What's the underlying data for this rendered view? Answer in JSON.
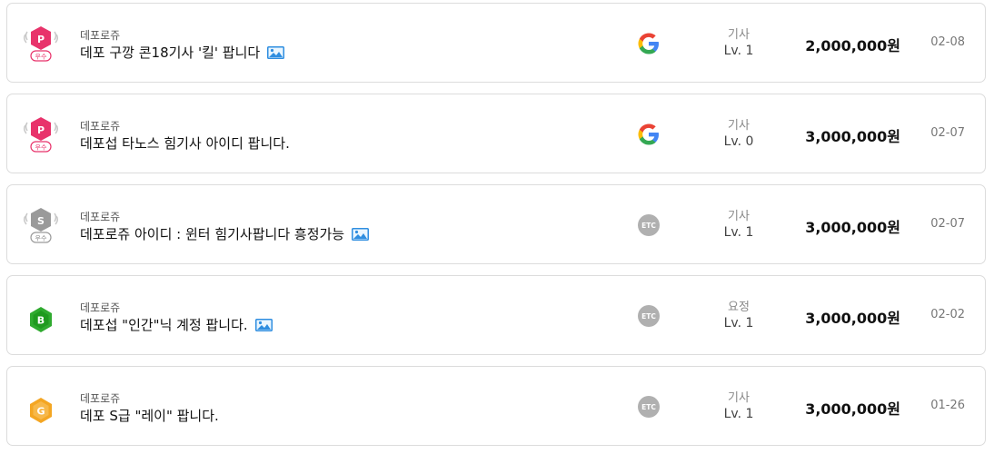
{
  "colors": {
    "premium_badge": "#e8336b",
    "silver_badge": "#9a9a9a",
    "bronze_badge": "#2faa2f",
    "gold_badge": "#f4a623",
    "etc_badge": "#b0b0b0"
  },
  "listings": [
    {
      "badge": {
        "icon": "premium-p-badge-icon",
        "letter": "P",
        "tag": "우수"
      },
      "game": "데포로쥬",
      "title": "데포 구깡 콘18기사 '킬' 팝니다",
      "has_image": true,
      "platform": {
        "icon": "google-icon",
        "label": ""
      },
      "job": "기사",
      "level": "Lv. 1",
      "price": "2,000,000원",
      "date": "02-08"
    },
    {
      "badge": {
        "icon": "premium-p-badge-icon",
        "letter": "P",
        "tag": "우수"
      },
      "game": "데포로쥬",
      "title": "데포섭 타노스 힘기사 아이디 팝니다.",
      "has_image": false,
      "platform": {
        "icon": "google-icon",
        "label": ""
      },
      "job": "기사",
      "level": "Lv. 0",
      "price": "3,000,000원",
      "date": "02-07"
    },
    {
      "badge": {
        "icon": "silver-s-badge-icon",
        "letter": "S",
        "tag": "우수"
      },
      "game": "데포로쥬",
      "title": "데포로쥬 아이디 : 윈터 힘기사팝니다 흥정가능",
      "has_image": true,
      "platform": {
        "icon": "etc-icon",
        "label": "ETC"
      },
      "job": "기사",
      "level": "Lv. 1",
      "price": "3,000,000원",
      "date": "02-07"
    },
    {
      "badge": {
        "icon": "bronze-b-badge-icon",
        "letter": "B",
        "tag": ""
      },
      "game": "데포로쥬",
      "title": "데포섭 \"인간\"닉 계정 팝니다.",
      "has_image": true,
      "platform": {
        "icon": "etc-icon",
        "label": "ETC"
      },
      "job": "요정",
      "level": "Lv. 1",
      "price": "3,000,000원",
      "date": "02-02"
    },
    {
      "badge": {
        "icon": "gold-g-badge-icon",
        "letter": "G",
        "tag": ""
      },
      "game": "데포로쥬",
      "title": "데포 S급 \"레이\" 팝니다.",
      "has_image": false,
      "platform": {
        "icon": "etc-icon",
        "label": "ETC"
      },
      "job": "기사",
      "level": "Lv. 1",
      "price": "3,000,000원",
      "date": "01-26"
    }
  ]
}
